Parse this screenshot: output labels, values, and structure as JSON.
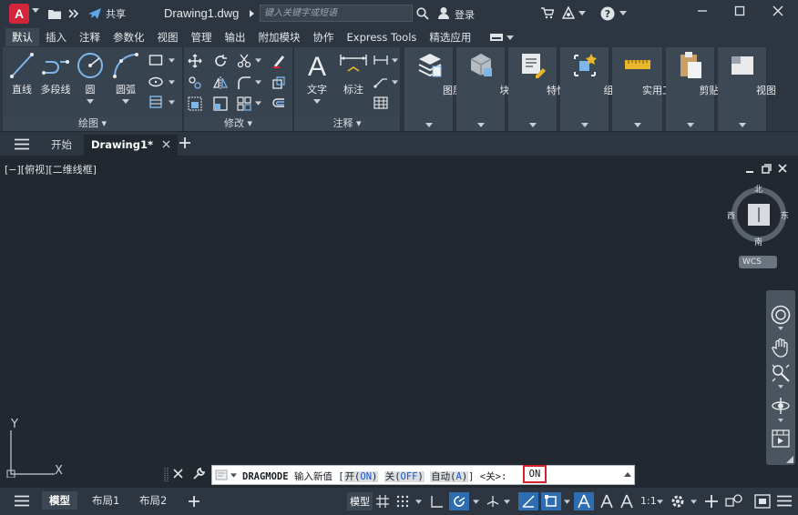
{
  "app": {
    "logo_letter": "A",
    "document_title": "Drawing1.dwg",
    "share_label": "共享",
    "search_placeholder": "键入关键字或短语",
    "login_label": "登录"
  },
  "ribbon_tabs": [
    "默认",
    "插入",
    "注释",
    "参数化",
    "视图",
    "管理",
    "输出",
    "附加模块",
    "协作",
    "Express Tools",
    "精选应用"
  ],
  "ribbon": {
    "draw": {
      "line": "直线",
      "polyline": "多段线",
      "circle": "圆",
      "arc": "圆弧",
      "footer": "绘图"
    },
    "modify": {
      "footer": "修改"
    },
    "annotation": {
      "text": "文字",
      "dimension": "标注",
      "footer": "注释"
    },
    "layers": "图层",
    "block": "块",
    "properties": "特性",
    "group": "组",
    "utilities": "实用工具",
    "clipboard": "剪贴板",
    "view": "视图"
  },
  "doc_tabs": {
    "start": "开始",
    "drawing": "Drawing1*"
  },
  "viewport": {
    "label": "[−][俯视][二维线框]",
    "compass": {
      "n": "北",
      "s": "南",
      "e": "东",
      "w": "西",
      "wcs": "WCS"
    },
    "ucs_x": "X",
    "ucs_y": "Y"
  },
  "command": {
    "name": "DRAGMODE",
    "prompt": "输入新值",
    "open_bracket": "[",
    "opt_on_cn": "开(",
    "opt_on_key": "ON",
    "opt_on_end": ")",
    "opt_off_cn": "关(",
    "opt_off_key": "OFF",
    "opt_off_end": ")",
    "opt_auto_cn": "自动(",
    "opt_auto_key": "A",
    "opt_auto_end": ")",
    "close_bracket": "]",
    "default": "<关>:",
    "input_value": "ON"
  },
  "status": {
    "model_tab": "模型",
    "layout1": "布局1",
    "layout2": "布局2",
    "model_btn": "模型",
    "scale": "1:1"
  }
}
